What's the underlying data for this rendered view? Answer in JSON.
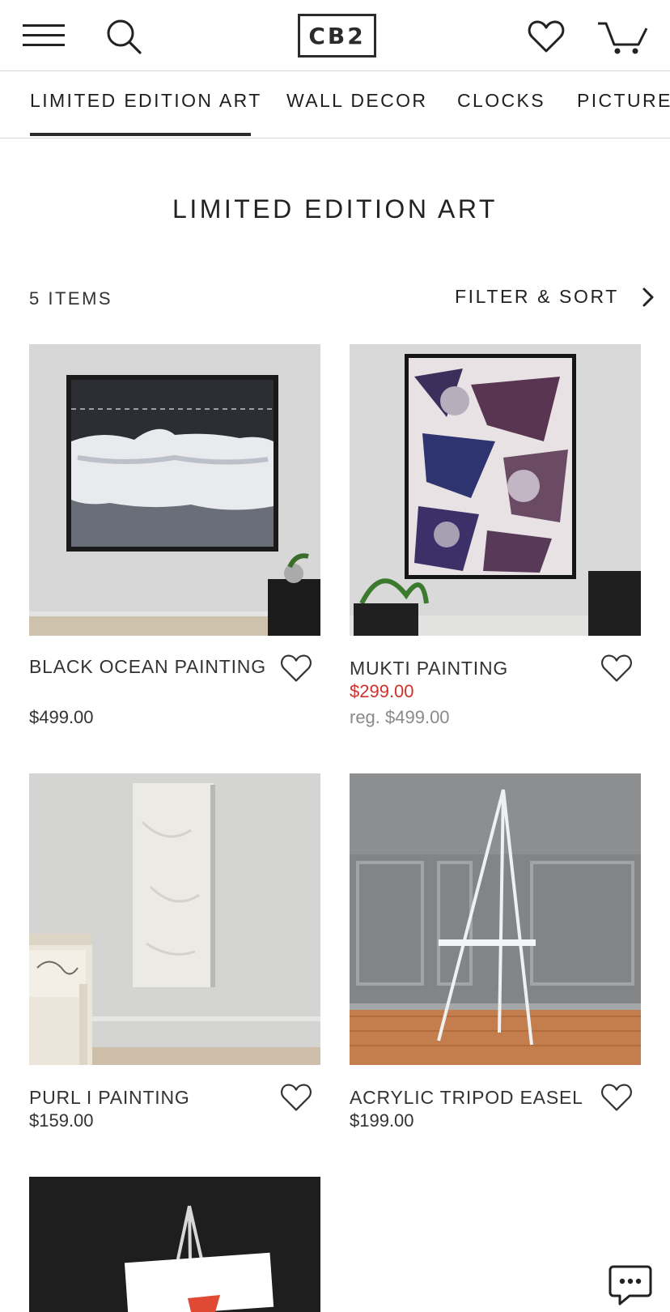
{
  "header": {
    "logo": "CB2",
    "icons": [
      "menu-icon",
      "search-icon",
      "heart-icon",
      "cart-icon"
    ]
  },
  "subnav": {
    "tabs": [
      "LIMITED EDITION ART",
      "WALL DECOR",
      "CLOCKS",
      "PICTURE"
    ],
    "active": "LIMITED EDITION ART"
  },
  "page": {
    "title": "LIMITED EDITION ART",
    "items_count": "5 ITEMS",
    "filter_sort": "FILTER & SORT"
  },
  "products": [
    {
      "name": "BLACK OCEAN PAINTING",
      "price": "$499.00"
    },
    {
      "name": "MUKTI PAINTING",
      "sale_price": "$299.00",
      "reg_price": "reg. $499.00"
    },
    {
      "name": "PURL I PAINTING",
      "price": "$159.00"
    },
    {
      "name": "ACRYLIC TRIPOD EASEL",
      "price": "$199.00"
    }
  ],
  "colors": {
    "text": "#222222",
    "sale": "#d0302a",
    "muted": "#8a8a8a",
    "border": "#d6d6d6"
  }
}
